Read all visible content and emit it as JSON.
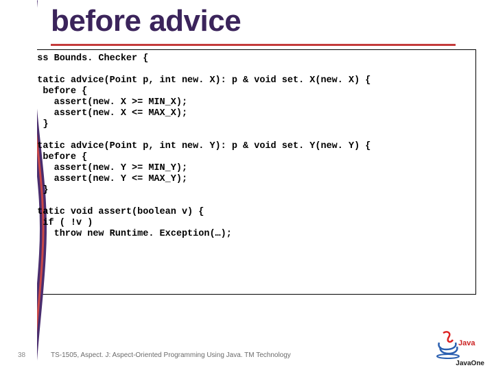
{
  "title": "before advice",
  "code": "class Bounds. Checker {\n\n  static advice(Point p, int new. X): p & void set. X(new. X) {\n    before {\n      assert(new. X >= MIN_X);\n      assert(new. X <= MAX_X);\n    }\n  }\n  static advice(Point p, int new. Y): p & void set. Y(new. Y) {\n    before {\n      assert(new. Y >= MIN_Y);\n      assert(new. Y <= MAX_Y);\n    }\n  }\n  static void assert(boolean v) {\n    if ( !v )\n      throw new Runtime. Exception(…);\n  }\n}",
  "slide_number": "38",
  "footer_text": "TS-1505, Aspect. J: Aspect-Oriented Programming Using Java. TM Technology",
  "logo_text": "JavaOne"
}
